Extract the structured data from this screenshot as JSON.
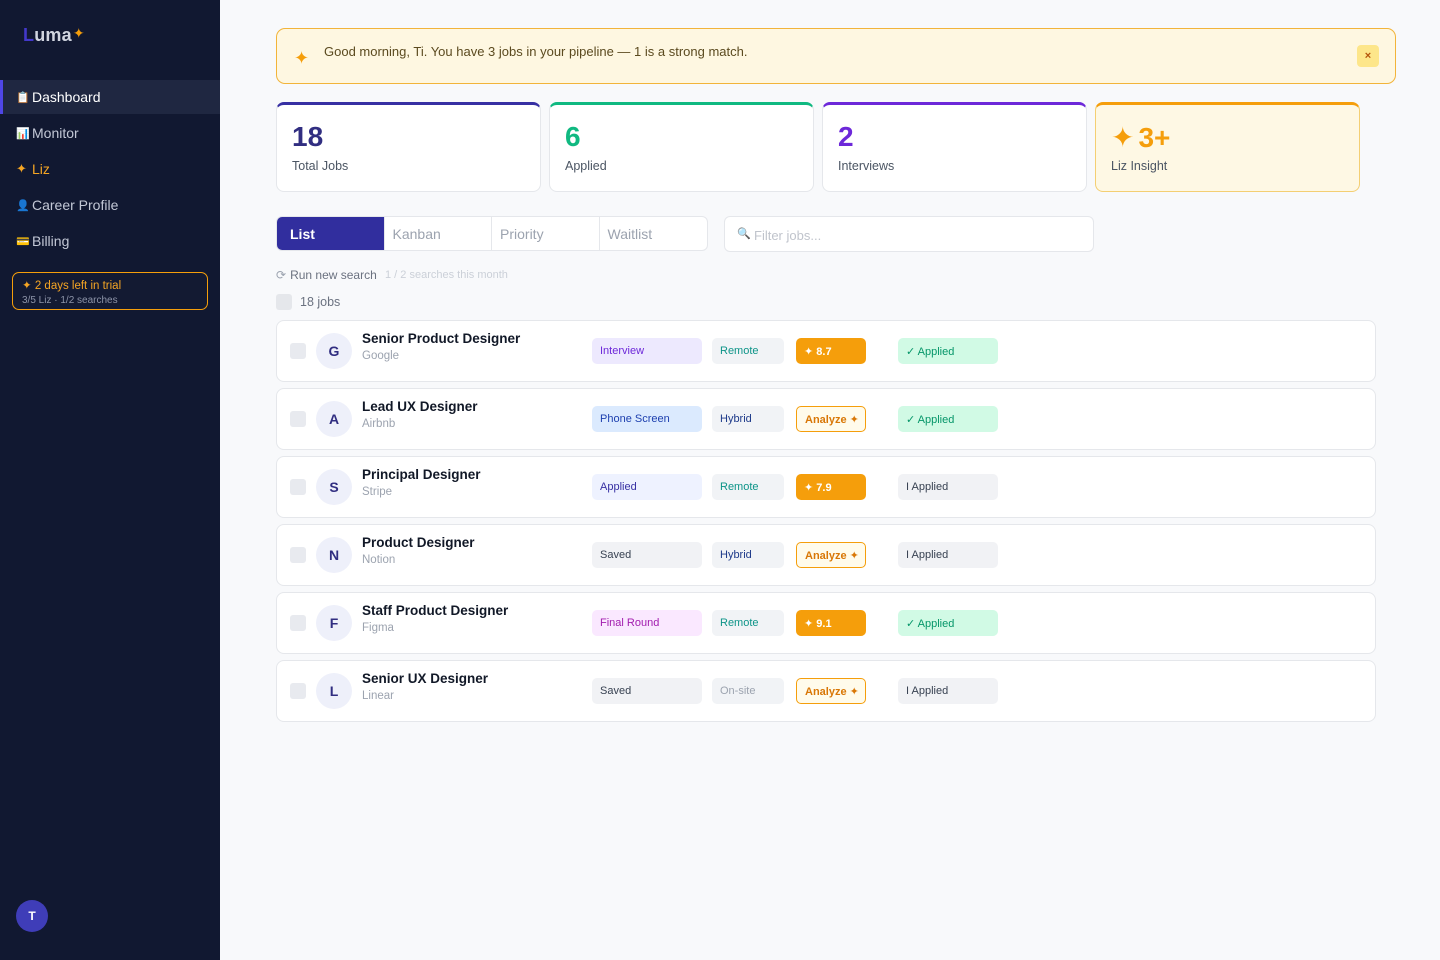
{
  "app": {
    "logo_letter": "L",
    "logo_rest": "uma",
    "logo_spark": "✦"
  },
  "sidebar": {
    "items": [
      {
        "icon": "📋",
        "label": "Dashboard"
      },
      {
        "icon": "📊",
        "label": "Monitor"
      },
      {
        "icon": "✦",
        "label": "Liz"
      },
      {
        "icon": "👤",
        "label": "Career Profile"
      },
      {
        "icon": "💳",
        "label": "Billing"
      }
    ],
    "trial_line1": "✦ 2 days left in trial",
    "trial_line2": "3/5 Liz · 1/2 searches",
    "avatar_initial": "T"
  },
  "banner": {
    "icon": "✦",
    "message": "Good morning, Ti. You have 3 jobs in your pipeline — 1 is a strong match.",
    "close": "×"
  },
  "stats": [
    {
      "value": "18",
      "label": "Total Jobs"
    },
    {
      "value": "6",
      "label": "Applied"
    },
    {
      "value": "2",
      "label": "Interviews"
    },
    {
      "icon": "✦",
      "value": "3+",
      "label": "Liz Insight"
    }
  ],
  "tabs": [
    "List",
    "Kanban",
    "Priority",
    "Waitlist"
  ],
  "filter": {
    "icon": "🔍",
    "placeholder": "Filter jobs..."
  },
  "run_search": {
    "icon": "⟳",
    "label": "Run new search",
    "count": "1 / 2 searches this month"
  },
  "job_count": "18 jobs",
  "jobs": [
    {
      "initial": "G",
      "title": "Senior Product Designer",
      "company": "Google",
      "stage": "Interview",
      "location": "Remote",
      "score": "✦ 8.7",
      "applied": "✓ Applied"
    },
    {
      "initial": "A",
      "title": "Lead UX Designer",
      "company": "Airbnb",
      "stage": "Phone Screen",
      "location": "Hybrid",
      "score": "Analyze ✦",
      "applied": "✓ Applied"
    },
    {
      "initial": "S",
      "title": "Principal Designer",
      "company": "Stripe",
      "stage": "Applied",
      "location": "Remote",
      "score": "✦ 7.9",
      "applied": "I Applied"
    },
    {
      "initial": "N",
      "title": "Product Designer",
      "company": "Notion",
      "stage": "Saved",
      "location": "Hybrid",
      "score": "Analyze ✦",
      "applied": "I Applied"
    },
    {
      "initial": "F",
      "title": "Staff Product Designer",
      "company": "Figma",
      "stage": "Final Round",
      "location": "Remote",
      "score": "✦ 9.1",
      "applied": "✓ Applied"
    },
    {
      "initial": "L",
      "title": "Senior UX Designer",
      "company": "Linear",
      "stage": "Saved",
      "location": "On-site",
      "score": "Analyze ✦",
      "applied": "I Applied"
    }
  ]
}
